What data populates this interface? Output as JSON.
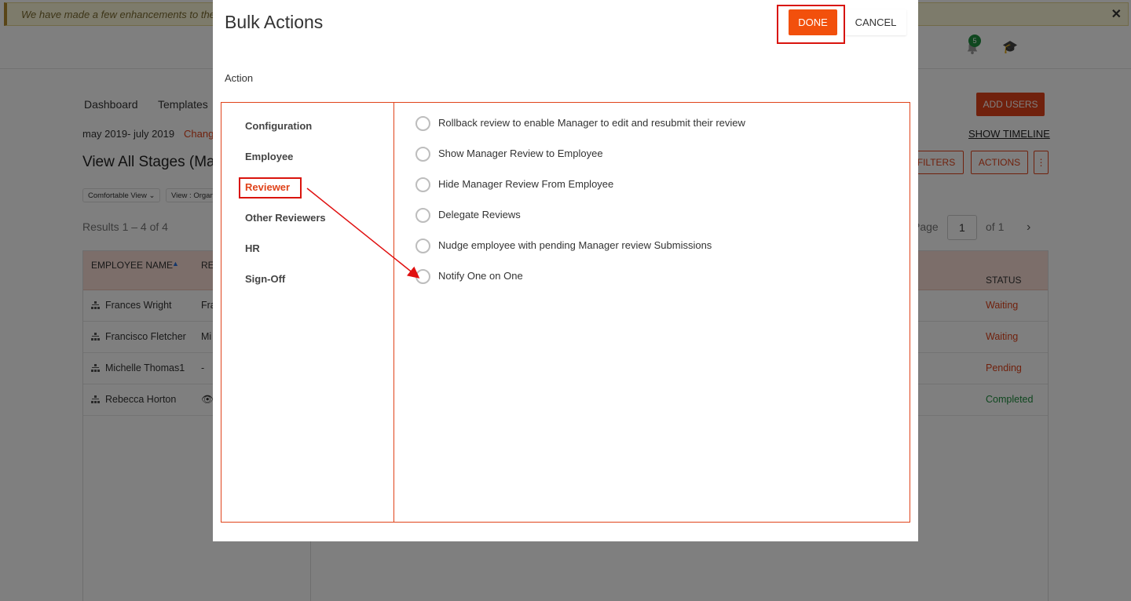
{
  "banner": {
    "text": "We have made a few enhancements to the C",
    "close": "✕"
  },
  "topbar": {
    "notification_count": "5"
  },
  "nav": [
    "Dashboard",
    "Templates"
  ],
  "period": {
    "range": "may 2019- july 2019",
    "change": "Chang"
  },
  "page_title": "View All Stages (May",
  "view_pills": [
    "Comfortable View ⌄",
    "View : Organ"
  ],
  "results": "Results 1 – 4 of 4",
  "header_actions": {
    "add_users": "ADD USERS",
    "show_timeline": "SHOW TIMELINE",
    "filters": "FILTERS",
    "actions": "ACTIONS",
    "more": "⋮"
  },
  "pager": {
    "page_label": "Page",
    "page_value": "1",
    "of_label": "of 1"
  },
  "table": {
    "headers": {
      "employee_name": "EMPLOYEE NAME",
      "reviewer": "RE",
      "status": "STATUS"
    },
    "rows": [
      {
        "name": "Frances Wright",
        "reviewer": "Fra",
        "status": "Waiting"
      },
      {
        "name": "Francisco Fletcher",
        "reviewer": "Mi",
        "status": "Waiting"
      },
      {
        "name": "Michelle Thomas1",
        "reviewer": "-",
        "status": "Pending"
      },
      {
        "name": "Rebecca Horton",
        "reviewer": "👁",
        "status": "Completed"
      }
    ]
  },
  "status_colors": {
    "Waiting": "#e0431a",
    "Pending": "#e0431a",
    "Completed": "#1e8e3e"
  },
  "modal": {
    "title": "Bulk Actions",
    "done": "DONE",
    "cancel": "CANCEL",
    "action_label": "Action",
    "categories": [
      "Configuration",
      "Employee",
      "Reviewer",
      "Other Reviewers",
      "HR",
      "Sign-Off"
    ],
    "active_category": "Reviewer",
    "options": [
      "Rollback review to enable Manager to edit and resubmit their review",
      "Show Manager Review to Employee",
      "Hide Manager Review From Employee",
      "Delegate Reviews",
      "Nudge employee with pending Manager review Submissions",
      "Notify One on One"
    ]
  },
  "colors": {
    "accent": "#e0431a",
    "done_button": "#f2500c",
    "highlight": "#d9140d"
  }
}
